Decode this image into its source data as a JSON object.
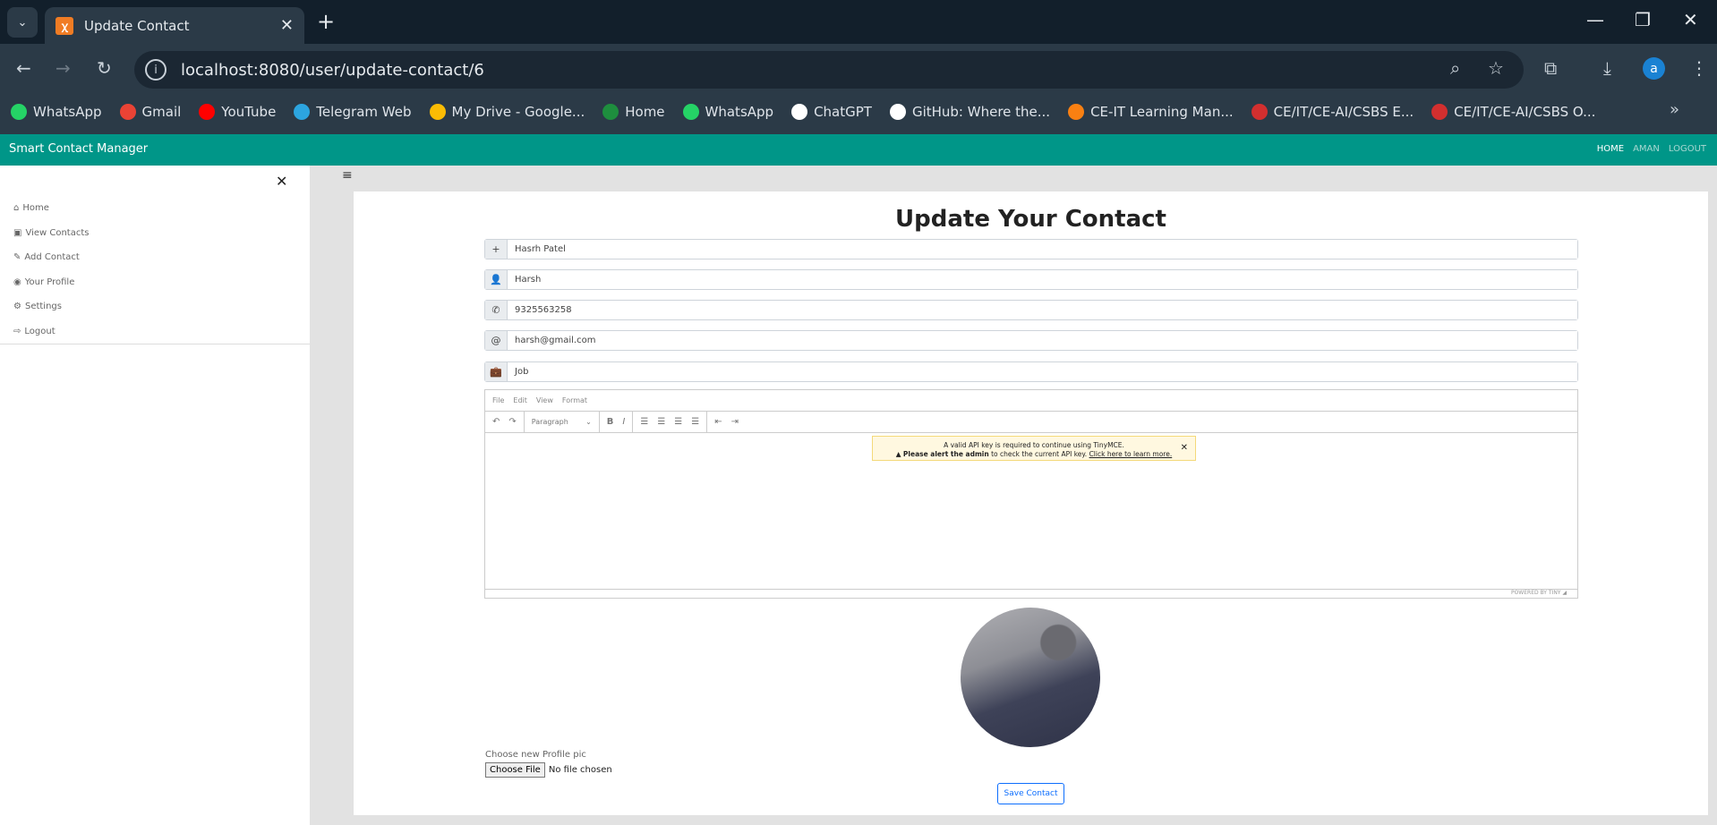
{
  "browser": {
    "tab_title": "Update Contact",
    "url": "localhost:8080/user/update-contact/6",
    "profile_initial": "a",
    "bookmarks": [
      {
        "label": "WhatsApp",
        "color": "#25d366"
      },
      {
        "label": "Gmail",
        "color": "#ea4335"
      },
      {
        "label": "YouTube",
        "color": "#ff0000"
      },
      {
        "label": "Telegram Web",
        "color": "#2ca5e0"
      },
      {
        "label": "My Drive - Google...",
        "color": "#fbbc04"
      },
      {
        "label": "Home",
        "color": "#1e8e3e"
      },
      {
        "label": "WhatsApp",
        "color": "#25d366"
      },
      {
        "label": "ChatGPT",
        "color": "#ffffff"
      },
      {
        "label": "GitHub: Where the...",
        "color": "#ffffff"
      },
      {
        "label": "CE-IT Learning Man...",
        "color": "#f98012"
      },
      {
        "label": "CE/IT/CE-AI/CSBS E...",
        "color": "#d32f2f"
      },
      {
        "label": "CE/IT/CE-AI/CSBS O...",
        "color": "#d32f2f"
      }
    ]
  },
  "navbar": {
    "brand": "Smart Contact Manager",
    "links": [
      "HOME",
      "AMAN",
      "LOGOUT"
    ],
    "color": "#009688"
  },
  "sidebar": {
    "items": [
      {
        "label": "Home",
        "icon": "home-icon",
        "glyph": "⌂"
      },
      {
        "label": "View Contacts",
        "icon": "id-badge-icon",
        "glyph": "▣"
      },
      {
        "label": "Add Contact",
        "icon": "pencil-icon",
        "glyph": "✎"
      },
      {
        "label": "Your Profile",
        "icon": "user-circle-icon",
        "glyph": "◉"
      },
      {
        "label": "Settings",
        "icon": "cogs-icon",
        "glyph": "⚙"
      },
      {
        "label": "Logout",
        "icon": "sign-out-icon",
        "glyph": "⇨"
      }
    ]
  },
  "form": {
    "title": "Update Your Contact",
    "fields": [
      {
        "icon": "plus-icon",
        "glyph": "+",
        "value": "Hasrh Patel"
      },
      {
        "icon": "user-icon",
        "glyph": "👤",
        "value": "Harsh"
      },
      {
        "icon": "phone-icon",
        "glyph": "✆",
        "value": "9325563258"
      },
      {
        "icon": "at-icon",
        "glyph": "@",
        "value": "harsh@gmail.com"
      },
      {
        "icon": "briefcase-icon",
        "glyph": "💼",
        "value": "Job"
      }
    ],
    "editor": {
      "menu": [
        "File",
        "Edit",
        "View",
        "Format"
      ],
      "block_format": "Paragraph",
      "notice_line1": "A valid API key is required to continue using TinyMCE.",
      "notice_bold": "Please alert the admin",
      "notice_mid": " to check the current API key. ",
      "notice_link": "Click here to learn more.",
      "powered": "POWERED BY TINY"
    },
    "pic_label": "Choose new Profile pic",
    "file_button": "Choose File",
    "file_status": "No file chosen",
    "save_label": "Save Contact"
  }
}
